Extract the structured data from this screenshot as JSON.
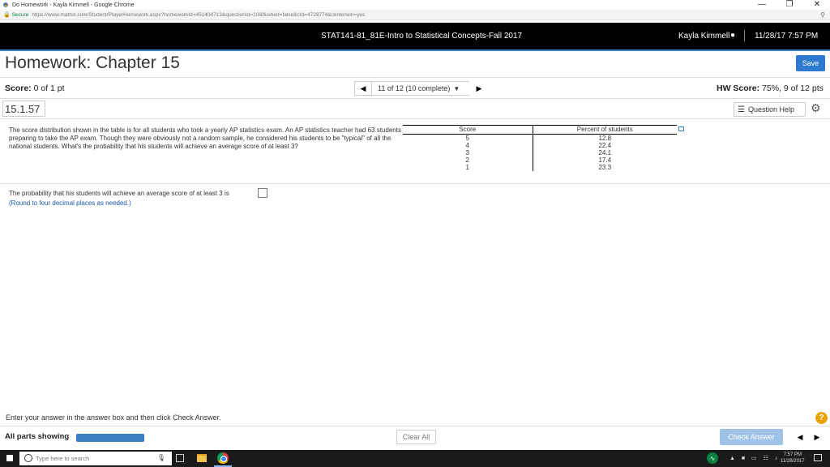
{
  "browser": {
    "window_title": "Do Homework - Kayla Kimmell - Google Chrome",
    "secure_label": "Secure",
    "url": "https://www.mathxl.com/Student/PlayerHomework.aspx?homeworkId=451404713&questionId=10&flushed=false&cId=4728774&centerwin=yes"
  },
  "header": {
    "course": "STAT141-81_81E-Intro to Statistical Concepts-Fall 2017",
    "user": "Kayla Kimmell",
    "datetime": "11/28/17 7:57 PM"
  },
  "homework": {
    "title": "Homework: Chapter 15",
    "save_label": "Save",
    "score_label": "Score:",
    "score_value": "0 of 1 pt",
    "question_selector": "11 of 12 (10 complete)",
    "hw_score_label": "HW Score:",
    "hw_score_value": "75%, 9 of 12 pts",
    "question_number": "15.1.57",
    "question_help_label": "Question Help"
  },
  "question": {
    "text": "The score distribution shown in the table is for all students who took a yearly AP statistics exam. An AP statistics teacher had 63 students preparing to take the AP exam. Though they were obviously not a random sample, he considered his students to be \"typical\" of all the national students. What's the probability that his students will achieve an average score of at least 3?",
    "table": {
      "headers": [
        "Score",
        "Percent of students"
      ],
      "rows": [
        [
          "5",
          "12.8"
        ],
        [
          "4",
          "22.4"
        ],
        [
          "3",
          "24.1"
        ],
        [
          "2",
          "17.4"
        ],
        [
          "1",
          "23.3"
        ]
      ]
    },
    "answer_prompt": "The probability that his students will achieve an average score of at least 3 is",
    "answer_value": "",
    "round_hint": "(Round to four decimal places as needed.)"
  },
  "footer": {
    "instruction": "Enter your answer in the answer box and then click Check Answer.",
    "all_parts_label": "All parts showing",
    "progress_fraction": 1.0,
    "clear_all_label": "Clear All",
    "check_answer_label": "Check Answer",
    "help_symbol": "?"
  },
  "taskbar": {
    "search_placeholder": "Type here to search",
    "clock_time": "7:57 PM",
    "clock_date": "11/28/2017"
  },
  "colors": {
    "accent": "#2d7bd1",
    "header_bg": "#000000",
    "help_badge": "#e8a300",
    "check_answer_disabled": "#9fc3e7"
  }
}
